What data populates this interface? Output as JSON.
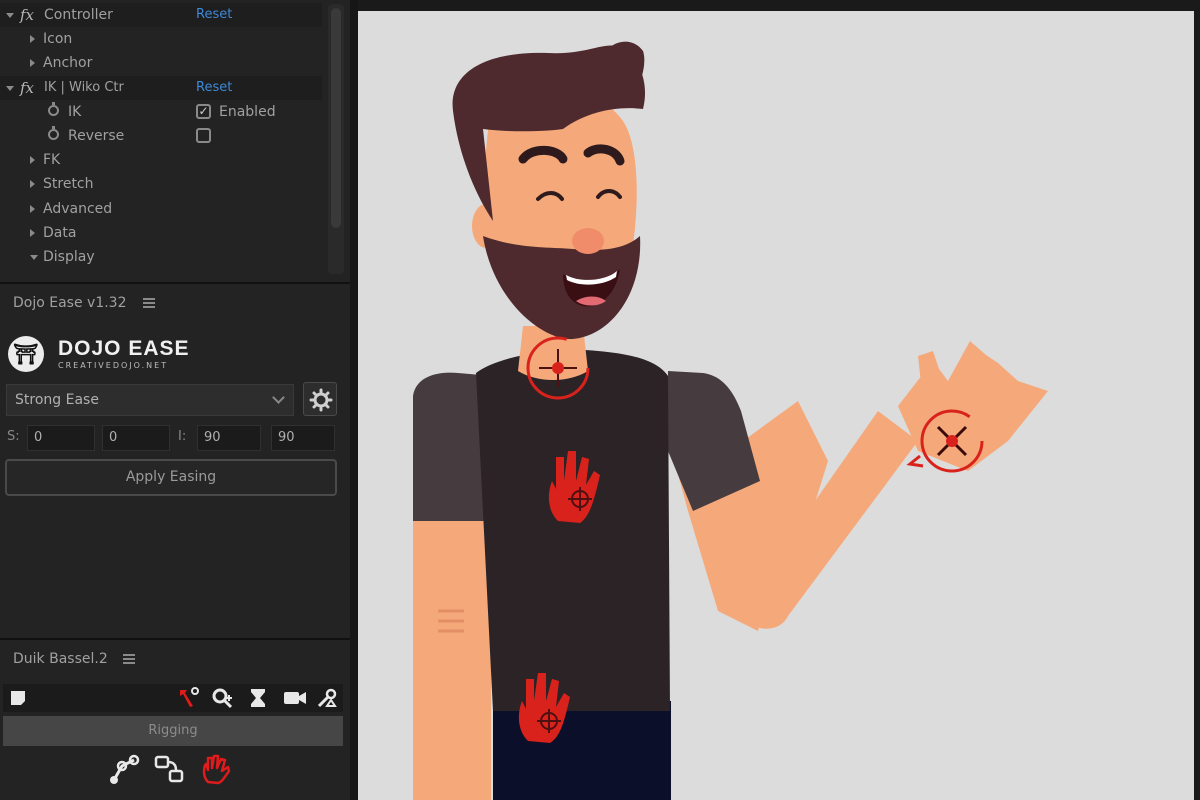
{
  "effects": {
    "controller": {
      "fx": "fx",
      "name": "Controller",
      "reset": "Reset"
    },
    "items_top": [
      "Icon",
      "Anchor"
    ],
    "ik": {
      "fx": "fx",
      "name": "IK | Wiko Ctr",
      "reset": "Reset"
    },
    "ik_prop": {
      "label": "IK",
      "value": "Enabled",
      "checked": true
    },
    "reverse_prop": {
      "label": "Reverse",
      "checked": false
    },
    "groups": [
      "FK",
      "Stretch",
      "Advanced",
      "Data"
    ],
    "display": "Display"
  },
  "dojo": {
    "panel_title": "Dojo Ease v1.32",
    "logo_glyph": "⛩",
    "title": "DOJO EASE",
    "subtitle": "CREATIVEDOJO.NET",
    "preset": "Strong Ease",
    "s_label": "S:",
    "s_values": [
      "0",
      "0"
    ],
    "i_label": "I:",
    "i_values": [
      "90",
      "90"
    ],
    "apply_label": "Apply Easing"
  },
  "duik": {
    "panel_title": "Duik Bassel.2",
    "rigging_label": "Rigging",
    "accent": "#e01b1b"
  },
  "colors": {
    "skin": "#f5a97a",
    "shirt": "#2c2326",
    "sleeve": "#463c3f",
    "hair": "#4e2a2e",
    "pants": "#0b0f2a",
    "canvas_bg": "#dcdcdc",
    "controller": "#d9221c"
  }
}
